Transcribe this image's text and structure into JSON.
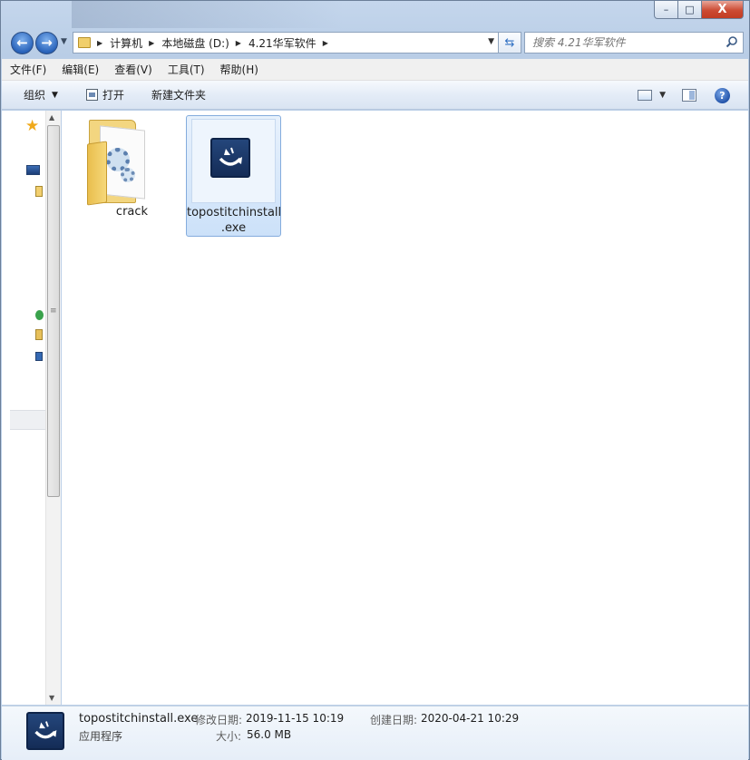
{
  "window": {
    "caption_min": "–",
    "caption_max": "□",
    "caption_close": "X"
  },
  "nav": {
    "back_glyph": "←",
    "forward_glyph": "→",
    "breadcrumbs": [
      "计算机",
      "本地磁盘 (D:)",
      "4.21华军软件"
    ],
    "search_placeholder": "搜索 4.21华军软件"
  },
  "menu": [
    "文件(F)",
    "编辑(E)",
    "查看(V)",
    "工具(T)",
    "帮助(H)"
  ],
  "commands": {
    "organize": "组织",
    "open": "打开",
    "new_folder": "新建文件夹",
    "help_glyph": "?"
  },
  "files": [
    {
      "name": "crack",
      "kind": "folder",
      "selected": false
    },
    {
      "name_line1": "topostitchinstall",
      "name_line2": ".exe",
      "kind": "exe",
      "selected": true
    }
  ],
  "details": {
    "filename": "topostitchinstall.exe",
    "type": "应用程序",
    "modified_label": "修改日期:",
    "modified_value": "2019-11-15 10:19",
    "size_label": "大小:",
    "size_value": "56.0 MB",
    "created_label": "创建日期:",
    "created_value": "2020-04-21 10:29"
  },
  "colors": {
    "selection_fill": "#cce1f9",
    "selection_border": "#84acdd",
    "exe_icon_bg": "#1b3765",
    "close_button": "#c8432b"
  }
}
